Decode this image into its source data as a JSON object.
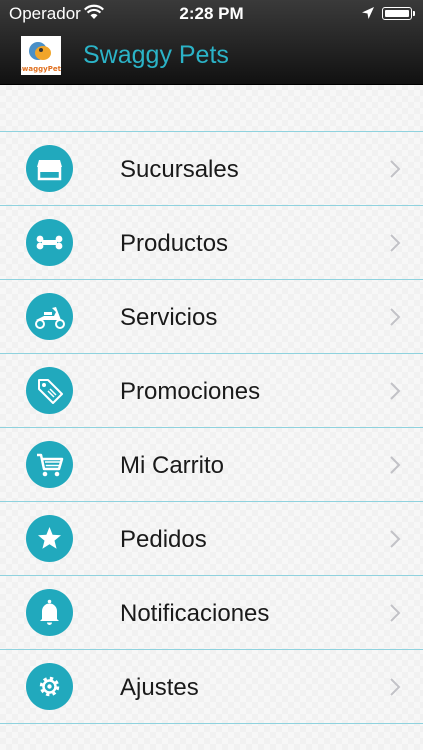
{
  "status_bar": {
    "carrier": "Operador",
    "time": "2:28 PM",
    "icons": [
      "wifi-icon",
      "location-arrow-icon",
      "battery-icon"
    ]
  },
  "nav": {
    "title": "Swaggy Pets",
    "logo": "swaggy-pets-logo",
    "logo_text": "SwaggyPets"
  },
  "colors": {
    "accent": "#21a9bd",
    "title": "#2bb3c7",
    "divider": "#8fd2de",
    "bar": "#1c1c1c"
  },
  "menu": {
    "items": [
      {
        "label": "Sucursales",
        "icon": "store-icon"
      },
      {
        "label": "Productos",
        "icon": "bone-icon"
      },
      {
        "label": "Servicios",
        "icon": "scooter-icon"
      },
      {
        "label": "Promociones",
        "icon": "price-tag-icon"
      },
      {
        "label": "Mi Carrito",
        "icon": "shopping-cart-icon"
      },
      {
        "label": "Pedidos",
        "icon": "star-icon"
      },
      {
        "label": "Notificaciones",
        "icon": "bell-icon"
      },
      {
        "label": "Ajustes",
        "icon": "gear-icon"
      }
    ]
  }
}
